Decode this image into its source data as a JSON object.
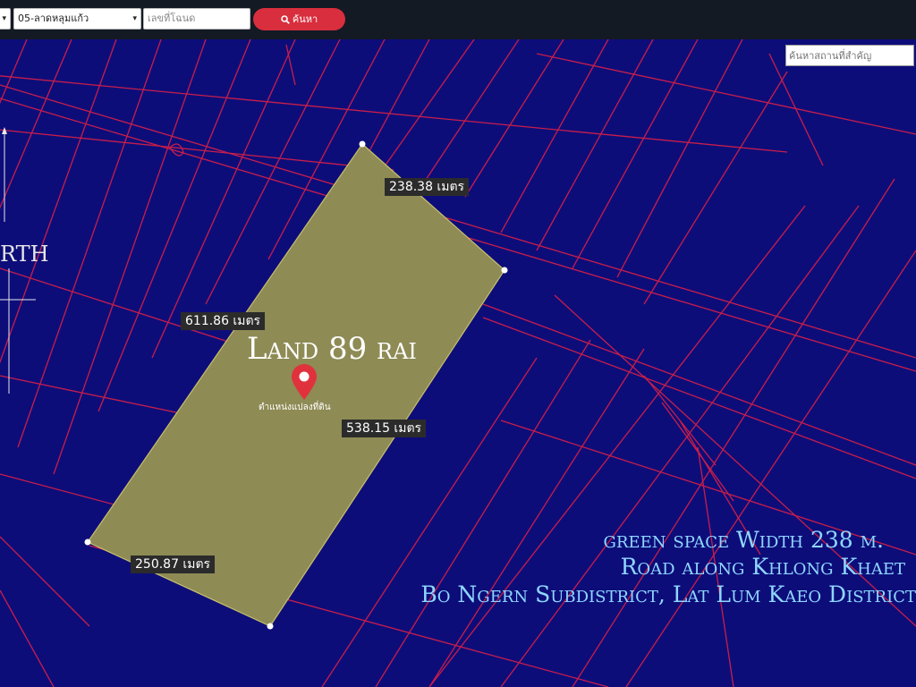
{
  "toolbar": {
    "province_arrow": "▾",
    "district_select": "05-ลาดหลุมแก้ว",
    "deed_placeholder": "เลขที่โฉนด",
    "search_label": "ค้นหา"
  },
  "map": {
    "place_search_placeholder": "ค้นหาสถานที่สำคัญ",
    "north_label": "RTH",
    "land_title": "Land 89 rai",
    "marker_label": "ตำแหน่งแปลงที่ดิน",
    "dimensions": {
      "top": "238.38 เมตร",
      "left": "611.86 เมตร",
      "right": "538.15 เมตร",
      "bottom": "250.87 เมตร"
    },
    "annotation": {
      "line1": "green space Width 238 m.",
      "line2": "Road along Khlong Khaet",
      "line3": "Bo Ngern Subdistrict, Lat Lum Kaeo District"
    },
    "colors": {
      "background": "#0d0d7a",
      "parcel_lines": "#c81e4a",
      "land_fill": "#8e8b55",
      "marker": "#e0323c",
      "annotation_text": "#8fd7ff"
    }
  }
}
